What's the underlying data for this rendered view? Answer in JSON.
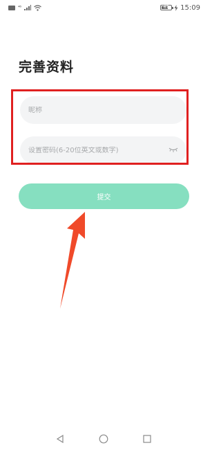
{
  "status_bar": {
    "signal_text": "⁴⁶",
    "battery_level": "67",
    "battery_fill_fraction": 0.67,
    "time": "15:09"
  },
  "page": {
    "title": "完善资料"
  },
  "form": {
    "nickname": {
      "placeholder": "昵称",
      "value": ""
    },
    "password": {
      "placeholder": "设置密码(6-20位英文或数字)",
      "value": "",
      "toggle_icon": "eye-closed-icon"
    },
    "submit_label": "提交"
  },
  "annotation": {
    "box_color": "#e02020",
    "arrow_color": "#f04a2a"
  },
  "colors": {
    "accent": "#86dfc0",
    "field_bg": "#f3f4f5",
    "placeholder": "#a7a9ab"
  },
  "nav_bar": {
    "icons": [
      "back-icon",
      "home-icon",
      "recent-apps-icon"
    ]
  }
}
